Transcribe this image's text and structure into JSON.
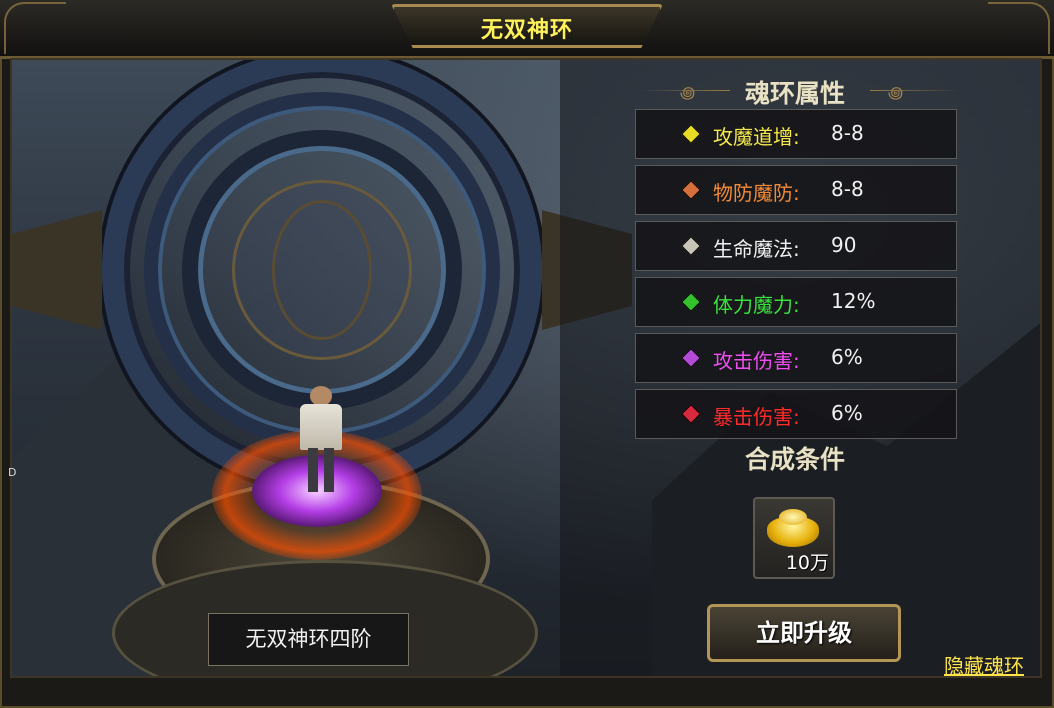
{
  "window": {
    "title": "无双神环"
  },
  "attributes_section": {
    "title": "魂环属性"
  },
  "attributes": [
    {
      "label": "攻魔道增:",
      "value": "8-8",
      "color": "#f5e84a",
      "gem_color": "#e9dc25"
    },
    {
      "label": "物防魔防:",
      "value": "8-8",
      "color": "#f28a37",
      "gem_color": "#d5703d"
    },
    {
      "label": "生命魔法:",
      "value": "90",
      "color": "#f2f2f2",
      "gem_color": "#c9c4b8"
    },
    {
      "label": "体力魔力:",
      "value": "12%",
      "color": "#39e13c",
      "gem_color": "#35c12b"
    },
    {
      "label": "攻击伤害:",
      "value": "6%",
      "color": "#f14ef1",
      "gem_color": "#b44bd8"
    },
    {
      "label": "暴击伤害:",
      "value": "6%",
      "color": "#ff2a2a",
      "gem_color": "#d82a3e"
    }
  ],
  "synthesis_section": {
    "title": "合成条件"
  },
  "cost_item": {
    "icon": "gold-ingot-icon",
    "count": "10万"
  },
  "buttons": {
    "upgrade": "立即升级",
    "hide_ring": "隐藏魂环"
  },
  "stage_label": "无双神环四阶",
  "edge_marker": "D"
}
